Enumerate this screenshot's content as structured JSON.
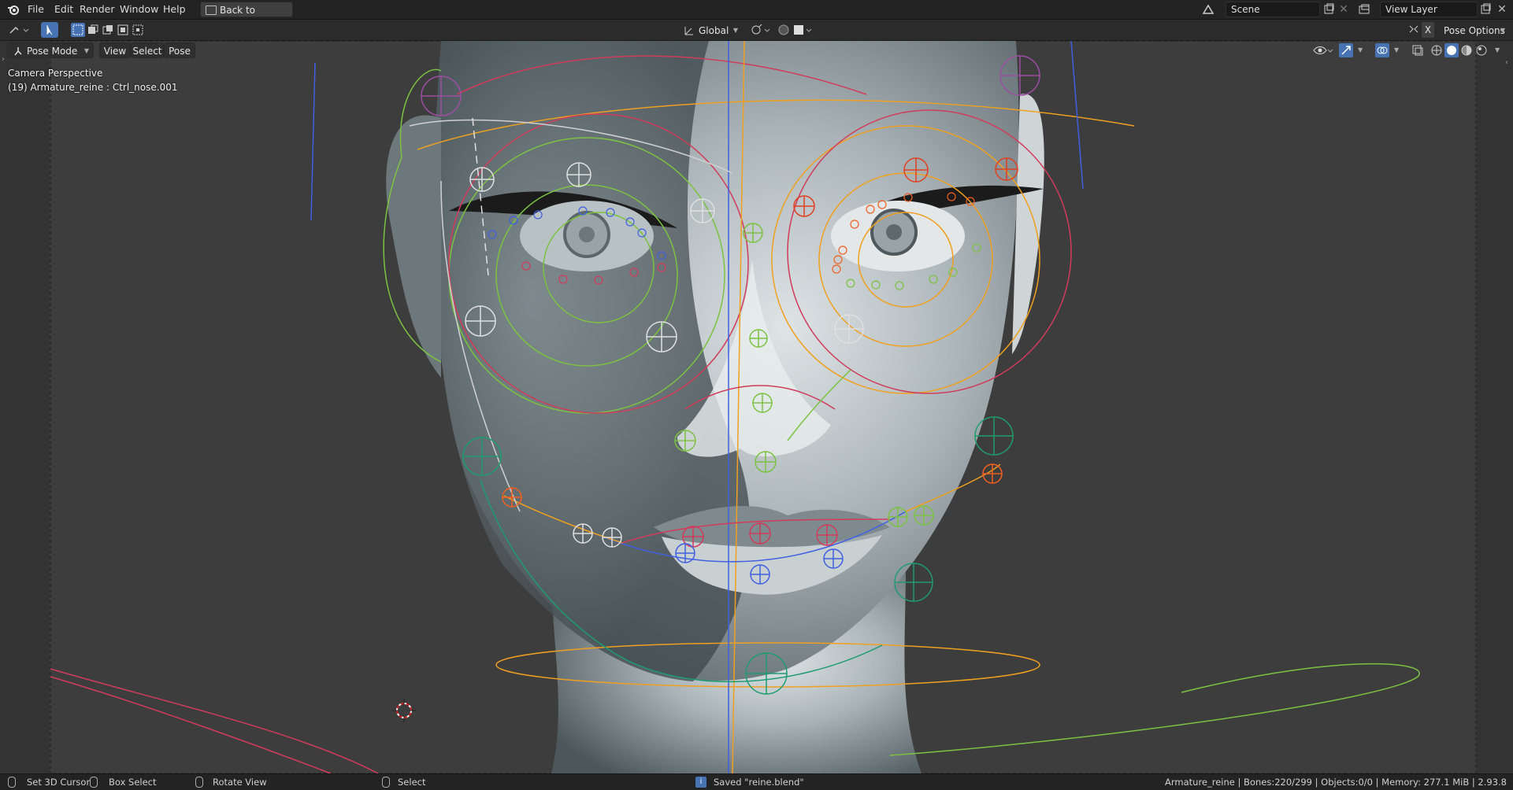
{
  "menu": {
    "items": [
      "File",
      "Edit",
      "Render",
      "Window",
      "Help"
    ],
    "back_button": "Back to Previous"
  },
  "top_right": {
    "scene_label": "Scene",
    "view_layer_label": "View Layer"
  },
  "transform": {
    "orientation": "Global"
  },
  "viewport_header": {
    "mode": "Pose Mode",
    "view": "View",
    "select": "Select",
    "pose": "Pose",
    "pose_options": "Pose Options",
    "x_mirror": "X"
  },
  "overlay": {
    "camera": "Camera Perspective",
    "active": "(19) Armature_reine : Ctrl_nose.001"
  },
  "status": {
    "set_cursor": "Set 3D Cursor",
    "box_select": "Box Select",
    "rotate_view": "Rotate View",
    "select": "Select",
    "saved": "Saved \"reine.blend\"",
    "stats": "Armature_reine | Bones:220/299 | Objects:0/0 | Memory: 277.1 MiB | 2.93.8"
  },
  "colors": {
    "accent": "#4772b3",
    "rig_orange": "#f0a020",
    "rig_red": "#d03c5a",
    "rig_green": "#7cc242",
    "rig_blue": "#4060e0"
  }
}
